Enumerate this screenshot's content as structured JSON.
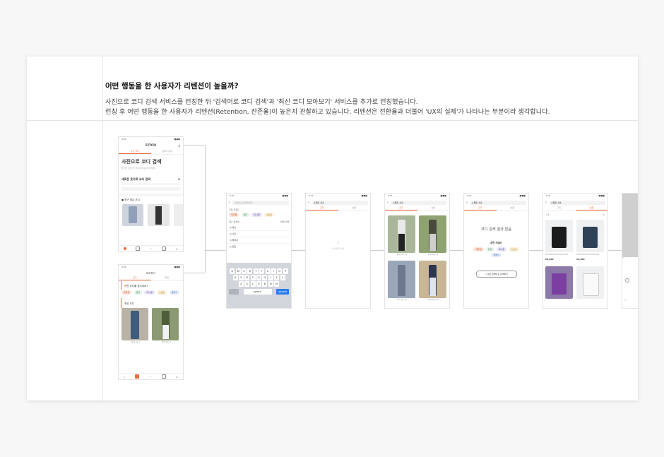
{
  "section": {
    "title": "어떤 행동을 한 사용자가 리텐션이 높을까?",
    "desc1": "사진으로 코디 검색 서비스를 런칭한 뒤 '검색어로 코디 검색'과 '최신 코디 모아보기' 서비스를 추가로 런칭했습니다.",
    "desc2": "런칭 후 어떤 행동을 한 사용자가 리텐션(Retention, 잔존율)이 높은지 관찰하고 있습니다. 리텐션은 전환율과 더불어 'UX의 실체'가 나타나는 부분이라 생각합니다."
  },
  "screens": {
    "home": {
      "brand": "FITCO",
      "tab1": "사진 검색",
      "tab2": "검색어 검색",
      "headline": "사진으로 코디 검색",
      "sub": "옷 사진 한 장으로 비슷한 코디를 찾아보세요",
      "cta": "새로운 옷으로 코디 검색",
      "recent": "최근 찾은 코디"
    },
    "feed": {
      "title": "모아보기",
      "tab1": "인기",
      "tab2": "최신",
      "q": "어떤 코디를 찾으세요?",
      "chips": [
        "캐주얼",
        "댄디",
        "미니멀",
        "스트릿",
        "클래식"
      ],
      "latest": "최신 코디",
      "cap1": "Monday_1",
      "cap2": "Monday_2"
    },
    "search": {
      "placeholder": "검색어를 입력하세요",
      "rec": "추천 키워드",
      "chips": [
        "캐주얼",
        "댄디",
        "미니멀",
        "스트릿"
      ],
      "recent": "최근 검색어",
      "clear": "전체 삭제",
      "items": [
        "셔츠",
        "니트",
        "청바지",
        "코트"
      ],
      "row1": [
        "Q",
        "W",
        "E",
        "R",
        "T",
        "Y",
        "U",
        "I",
        "O",
        "P"
      ],
      "row2": [
        "A",
        "S",
        "D",
        "F",
        "G",
        "H",
        "J",
        "K",
        "L"
      ],
      "row3": [
        "Z",
        "X",
        "C",
        "V",
        "B",
        "N",
        "M"
      ],
      "space": "space",
      "go": "search"
    },
    "empty": {
      "query": "스웨트 셔츠",
      "tab1": "코디",
      "tab2": "상품",
      "msg": "검색 결과 없음"
    },
    "results": {
      "query": "스웨트 셔츠",
      "tab1": "코디",
      "tab2": "상품",
      "caps": [
        "Monday_10",
        "Monday_11",
        "Monday_12",
        "Monday_13"
      ]
    },
    "noresult": {
      "query": "스웨트 셔츠",
      "tab1": "코디",
      "tab2": "상품",
      "title": "코디 검색 결과 없음",
      "rec": "추천 키워드",
      "chips": [
        "캐주얼",
        "댄디",
        "미니멀",
        "스트릿",
        "클래식"
      ],
      "btn": "다른 검색어로 검색하기"
    },
    "products": {
      "query": "스웨트 셔츠",
      "tab1": "코디",
      "tab2": "상품",
      "count": "2개",
      "price1": "29,900",
      "price2": "29,900"
    }
  },
  "colors": {
    "accent": "#f06a3c",
    "chip_bg": "#fde4d9"
  }
}
